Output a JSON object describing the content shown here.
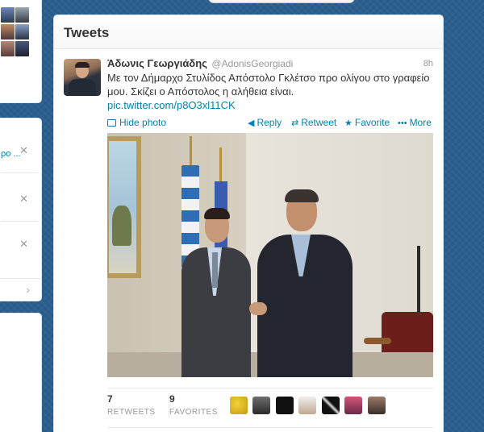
{
  "main": {
    "title": "Tweets"
  },
  "tweet": {
    "name": "Άδωνις Γεωργιάδης",
    "handle": "@AdonisGeorgiadi",
    "time": "8h",
    "text": "Με τον Δήμαρχο Στυλίδος Απόστολο Γκλέτσο προ ολίγου στο γραφείο μου. Σκίζει ο Απόστολος η αλήθεια είναι.",
    "link": "pic.twitter.com/p8O3xl11CK",
    "actions": {
      "hide_photo": "Hide photo",
      "reply": "Reply",
      "retweet": "Retweet",
      "favorite": "Favorite",
      "more": "More"
    },
    "stats": {
      "retweets_count": "7",
      "retweets_label": "RETWEETS",
      "favorites_count": "9",
      "favorites_label": "FAVORITES"
    }
  },
  "left": {
    "follow_link": "ρο ..."
  },
  "colors": {
    "link": "#0084b4",
    "background": "#2b5f8f"
  }
}
